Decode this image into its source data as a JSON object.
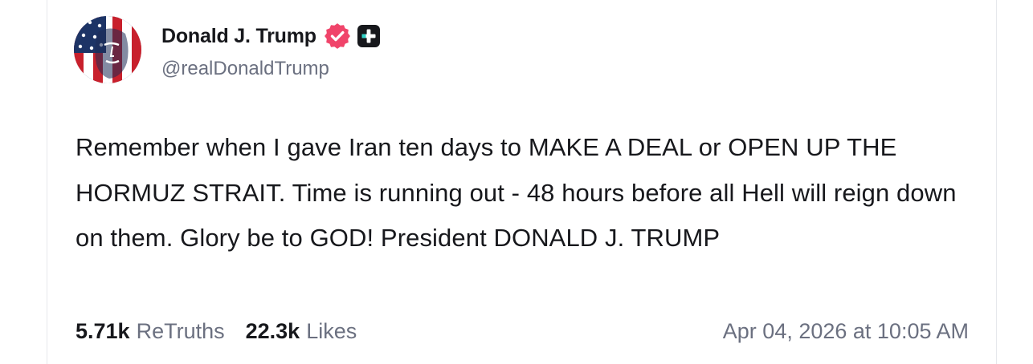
{
  "post": {
    "author": {
      "display_name": "Donald J. Trump",
      "handle": "@realDonaldTrump",
      "avatar_icon": "american-flag-portrait-avatar",
      "verified_icon": "verified-badge-icon",
      "verified_color": "#f0446a",
      "plus_icon": "plus-badge-icon"
    },
    "text": "Remember when I gave Iran ten days to MAKE A DEAL or OPEN UP THE HORMUZ STRAIT. Time is running out - 48 hours before all Hell will reign down on them. Glory be to GOD! President DONALD J. TRUMP",
    "stats": {
      "retruths_count": "5.71k",
      "retruths_label": "ReTruths",
      "likes_count": "22.3k",
      "likes_label": "Likes"
    },
    "timestamp": "Apr 04, 2026 at 10:05 AM"
  }
}
